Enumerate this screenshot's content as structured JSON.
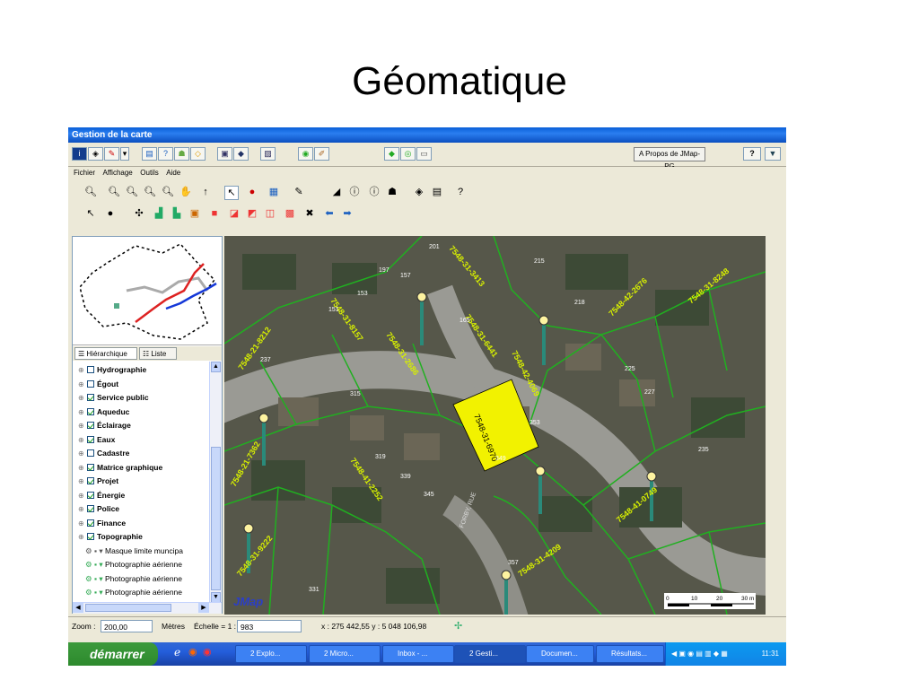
{
  "slide": {
    "title": "Géomatique"
  },
  "window": {
    "title": "Gestion de la carte"
  },
  "app_toolbar": {
    "about_label": "A Propos de JMap-PG",
    "help_label": "?",
    "dropdown_label": "▼"
  },
  "menu": {
    "items": [
      "Fichier",
      "Affichage",
      "Outils",
      "Aide"
    ]
  },
  "panel": {
    "tabs": [
      {
        "label": "Hiérarchique"
      },
      {
        "label": "Liste"
      }
    ],
    "layers": [
      {
        "label": "Hydrographie",
        "checked": false
      },
      {
        "label": "Égout",
        "checked": false
      },
      {
        "label": "Service public",
        "checked": true
      },
      {
        "label": "Aqueduc",
        "checked": true
      },
      {
        "label": "Éclairage",
        "checked": true
      },
      {
        "label": "Eaux",
        "checked": true
      },
      {
        "label": "Cadastre",
        "checked": false
      },
      {
        "label": "Matrice graphique",
        "checked": true
      },
      {
        "label": "Projet",
        "checked": true
      },
      {
        "label": "Énergie",
        "checked": true
      },
      {
        "label": "Police",
        "checked": true
      },
      {
        "label": "Finance",
        "checked": true
      },
      {
        "label": "Topographie",
        "checked": true
      }
    ],
    "sublayers": [
      "Masque limite muncipa",
      "Photographie aérienne",
      "Photographie aérienne",
      "Photographie aérienne"
    ]
  },
  "map": {
    "watermark": "JMap",
    "selected_lot": "7548-31-6970",
    "street_label": "FORBY, RUE",
    "lot_labels": [
      "7548-31-6970",
      "7548-31-8157",
      "7548-42-4069",
      "7548-42-2676",
      "7548-31-6441",
      "7548-31-2686",
      "7548-31-8248",
      "7548-21-8212",
      "7548-41-2252",
      "7548-31-9222",
      "7548-41-0749",
      "7548-21-7362",
      "7548-31-4209",
      "7548-31-3413"
    ],
    "address_labels": [
      "201",
      "197",
      "151",
      "153",
      "157",
      "165",
      "215",
      "218",
      "225",
      "227",
      "235",
      "237",
      "315",
      "319",
      "339",
      "345",
      "349",
      "353",
      "357",
      "331"
    ],
    "scale_bar": {
      "ticks": [
        "0",
        "10",
        "20",
        "30 m"
      ]
    }
  },
  "status": {
    "zoom_label": "Zoom :",
    "zoom_value": "200,00",
    "units_label": "Mètres",
    "scale_label": "Échelle = 1 :",
    "scale_value": "983",
    "coords": "x : 275 442,55  y : 5 048 106,98"
  },
  "taskbar": {
    "start_label": "démarrer",
    "tasks": [
      "2 Explo...",
      "2 Micro...",
      "Inbox - ...",
      "2 Gesti...",
      "Documen...",
      "Résultats..."
    ],
    "clock": "11:31"
  },
  "colors": {
    "selected_lot": "#f2f200",
    "parcel_line": "#20b020",
    "label_yellow": "#d8f000",
    "pole": "#2a8a7a"
  }
}
